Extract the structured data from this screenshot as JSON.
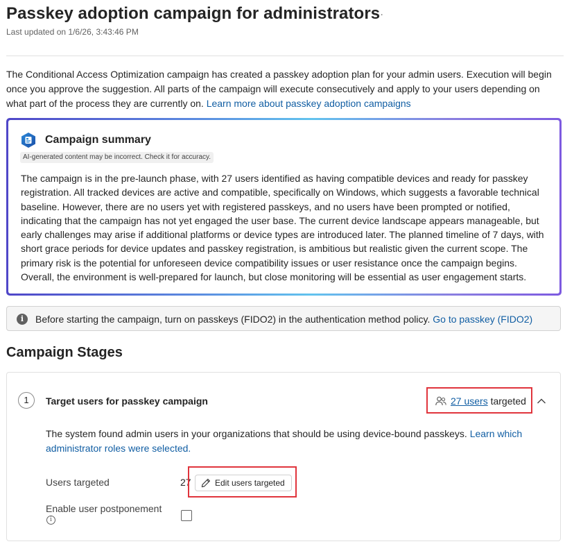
{
  "header": {
    "title": "Passkey adoption campaign for administrators",
    "more_label": "···",
    "last_updated": "Last updated on 1/6/26, 3:43:46 PM"
  },
  "intro": {
    "text": "The Conditional Access Optimization campaign has created a passkey adoption plan for your admin users. Execution will begin once you approve the suggestion. All parts of the campaign will execute consecutively and apply to your users depending on what part of the process they are currently on. ",
    "link": "Learn more about passkey adoption campaigns"
  },
  "summary": {
    "title": "Campaign summary",
    "ai_disclaimer": "AI-generated content may be incorrect. Check it for accuracy.",
    "text": "The campaign is in the pre-launch phase, with 27 users identified as having compatible devices and ready for passkey registration. All tracked devices are active and compatible, specifically on Windows, which suggests a favorable technical baseline. However, there are no users yet with registered passkeys, and no users have been prompted or notified, indicating that the campaign has not yet engaged the user base. The current device landscape appears manageable, but early challenges may arise if additional platforms or device types are introduced later. The planned timeline of 7 days, with short grace periods for device updates and passkey registration, is ambitious but realistic given the current scope. The primary risk is the potential for unforeseen device compatibility issues or user resistance once the campaign begins. Overall, the environment is well-prepared for launch, but close monitoring will be essential as user engagement starts."
  },
  "info_bar": {
    "text": "Before starting the campaign, turn on passkeys (FIDO2) in the authentication method policy. ",
    "link": "Go to passkey (FIDO2)"
  },
  "stages": {
    "heading": "Campaign Stages",
    "items": [
      {
        "number": "1",
        "title": "Target users for passkey campaign",
        "users_link": "27 users",
        "targeted_suffix": " targeted",
        "description": "The system found admin users in your organizations that should be using device-bound passkeys. ",
        "description_link": "Learn which administrator roles were selected.",
        "users_targeted_label": "Users targeted",
        "users_targeted_value": "27",
        "edit_button_label": "Edit users targeted",
        "postponement_label": "Enable user postponement",
        "postponement_enabled": false
      }
    ]
  },
  "colors": {
    "link": "#115ea3",
    "highlight": "#e0343c",
    "gradient": [
      "#4f46c8",
      "#62c3ee",
      "#7d5ae0"
    ]
  }
}
